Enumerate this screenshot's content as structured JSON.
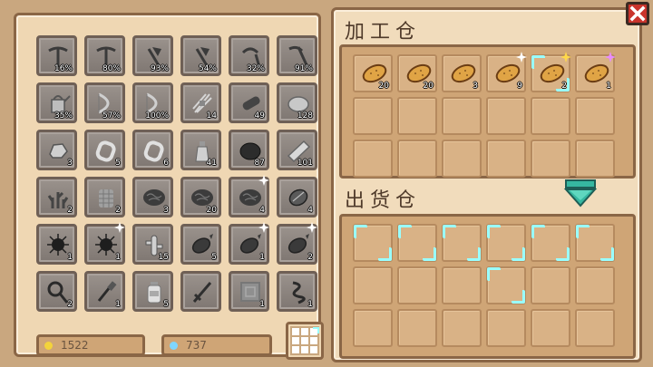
{
  "inventory": [
    {
      "name": "pickaxe",
      "count": "16%",
      "color": "#3a3a3a"
    },
    {
      "name": "pickaxe",
      "count": "80%",
      "color": "#3a3a3a"
    },
    {
      "name": "axe",
      "count": "93%",
      "color": "#3a3a3a"
    },
    {
      "name": "axe",
      "count": "54%",
      "color": "#3a3a3a"
    },
    {
      "name": "sickle",
      "count": "32%",
      "color": "#3a3a3a"
    },
    {
      "name": "scythe",
      "count": "91%",
      "color": "#3a3a3a"
    },
    {
      "name": "watering-can",
      "count": "35%",
      "color": "#bdbdbd"
    },
    {
      "name": "bow",
      "count": "57%",
      "color": "#cfcfcf"
    },
    {
      "name": "bow",
      "count": "100%",
      "color": "#cfcfcf"
    },
    {
      "name": "twig-bundle",
      "count": "14",
      "color": "#d6d6d6"
    },
    {
      "name": "log",
      "count": "49",
      "color": "#444444"
    },
    {
      "name": "stone",
      "count": "128",
      "color": "#c8c8c8"
    },
    {
      "name": "ore",
      "count": "3",
      "color": "#cfcfcf"
    },
    {
      "name": "ring",
      "count": "5",
      "color": "#e0e0e0"
    },
    {
      "name": "ring",
      "count": "6",
      "color": "#e0e0e0"
    },
    {
      "name": "bottle",
      "count": "41",
      "color": "#d0d0d0"
    },
    {
      "name": "coal",
      "count": "87",
      "color": "#2c2c2c"
    },
    {
      "name": "plank",
      "count": "101",
      "color": "#d8d8d8"
    },
    {
      "name": "coral",
      "count": "2",
      "color": "#444444"
    },
    {
      "name": "net",
      "count": "2",
      "color": "#a0a0a0"
    },
    {
      "name": "brain-coral",
      "count": "3",
      "color": "#3c3c3c"
    },
    {
      "name": "brain-coral",
      "count": "20",
      "color": "#3c3c3c"
    },
    {
      "name": "brain-coral",
      "count": "4",
      "color": "#3c3c3c",
      "star": true
    },
    {
      "name": "shell",
      "count": "4",
      "color": "#5a5a5a"
    },
    {
      "name": "sea-urchin",
      "count": "1",
      "color": "#1e1e1e"
    },
    {
      "name": "sea-urchin",
      "count": "1",
      "color": "#1e1e1e",
      "star": true
    },
    {
      "name": "cactus",
      "count": "15",
      "color": "#d0d0d0"
    },
    {
      "name": "fish",
      "count": "5",
      "color": "#3a3a3a"
    },
    {
      "name": "fish",
      "count": "1",
      "color": "#3a3a3a",
      "star": true
    },
    {
      "name": "fish",
      "count": "2",
      "color": "#3a3a3a",
      "star": true
    },
    {
      "name": "frying-pan",
      "count": "2",
      "color": "#2a2a2a"
    },
    {
      "name": "screwdriver",
      "count": "1",
      "color": "#2a2a2a"
    },
    {
      "name": "jar",
      "count": "5",
      "color": "#e0e0e0"
    },
    {
      "name": "sword",
      "count": "",
      "color": "#2f2f2f"
    },
    {
      "name": "crate",
      "count": "1",
      "color": "#8f8f8f"
    },
    {
      "name": "ribbon",
      "count": "1",
      "color": "#2a2a2a"
    }
  ],
  "currency": {
    "gold": "1522",
    "gems": "737",
    "gold_color": "#f3d33b",
    "gem_color": "#7fd6ff"
  },
  "processing": {
    "title": "加工仓",
    "row1": [
      {
        "count": "20",
        "star": ""
      },
      {
        "count": "20",
        "star": ""
      },
      {
        "count": "3",
        "star": ""
      },
      {
        "count": "9",
        "star": "white"
      },
      {
        "count": "2",
        "star": "gold",
        "hl": true
      },
      {
        "count": "1",
        "star": "pink"
      }
    ]
  },
  "output": {
    "title": "出货仓"
  },
  "icons": {
    "close": "close-icon",
    "arrow": "arrow-down-icon",
    "grid": "grid-icon"
  }
}
